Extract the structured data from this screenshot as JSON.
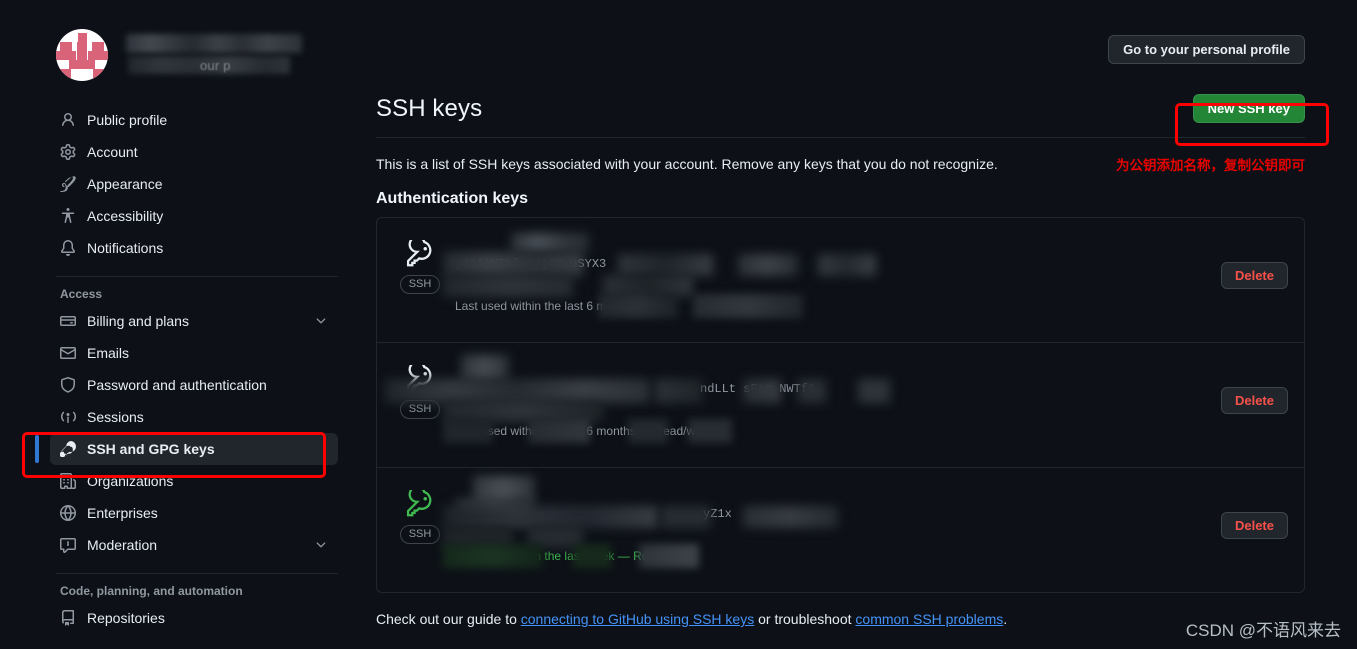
{
  "window": {
    "bg_color": "#0d1117",
    "accent_green": "#238636",
    "annotation_red": "#ff0000"
  },
  "sidebar": {
    "profile": {
      "name_redacted": "",
      "subtitle_partial": "our p"
    },
    "items": [
      {
        "label": "Public profile",
        "icon": "person-icon",
        "active": false,
        "chevron": false
      },
      {
        "label": "Account",
        "icon": "gear-icon",
        "active": false,
        "chevron": false
      },
      {
        "label": "Appearance",
        "icon": "paintbrush-icon",
        "active": false,
        "chevron": false
      },
      {
        "label": "Accessibility",
        "icon": "accessibility-icon",
        "active": false,
        "chevron": false
      },
      {
        "label": "Notifications",
        "icon": "bell-icon",
        "active": false,
        "chevron": false
      }
    ],
    "access_section": {
      "label": "Access",
      "items": [
        {
          "label": "Billing and plans",
          "icon": "credit-card-icon",
          "active": false,
          "chevron": true
        },
        {
          "label": "Emails",
          "icon": "mail-icon",
          "active": false,
          "chevron": false
        },
        {
          "label": "Password and authentication",
          "icon": "shield-icon",
          "active": false,
          "chevron": false
        },
        {
          "label": "Sessions",
          "icon": "broadcast-icon",
          "active": false,
          "chevron": false
        },
        {
          "label": "SSH and GPG keys",
          "icon": "key-icon",
          "active": true,
          "chevron": false
        },
        {
          "label": "Organizations",
          "icon": "organization-icon",
          "active": false,
          "chevron": false
        },
        {
          "label": "Enterprises",
          "icon": "globe-icon",
          "active": false,
          "chevron": false
        },
        {
          "label": "Moderation",
          "icon": "report-icon",
          "active": false,
          "chevron": true
        }
      ]
    },
    "code_section": {
      "label": "Code, planning, and automation",
      "items": [
        {
          "label": "Repositories",
          "icon": "repo-icon",
          "active": false,
          "chevron": false
        }
      ]
    }
  },
  "header": {
    "personal_profile_button": "Go to your personal profile",
    "title": "SSH keys",
    "new_key_button": "New SSH key",
    "description": "This is a list of SSH keys associated with your account. Remove any keys that you do not recognize.",
    "annotation_cn": "为公钥添加名称，复制公钥即可"
  },
  "main": {
    "section_heading": "Authentication keys",
    "keys": [
      {
        "title_redacted": true,
        "fingerprint_visible": "y232)MTbl        <jjCE           uSYX3",
        "added_redacted": true,
        "last_used": "Last used within the last 6 months",
        "last_used_recent": false,
        "icon_color": "white",
        "badge": "SSH",
        "delete_label": "Delete"
      },
      {
        "title_redacted": true,
        "fingerprint_visible": "ndLLt      sF+r     NWTf1",
        "added_redacted": true,
        "last_used": "Last used within the last 6 months — Read/write",
        "last_used_recent": false,
        "icon_color": "white",
        "badge": "SSH",
        "delete_label": "Delete"
      },
      {
        "title_redacted": true,
        "fingerprint_visible": "yZ1x",
        "added_redacted": true,
        "last_used": "Last used within the last week — Read/write",
        "last_used_recent": true,
        "icon_color": "green",
        "badge": "SSH",
        "delete_label": "Delete"
      }
    ],
    "footer": {
      "prefix": "Check out our guide to ",
      "link1": "connecting to GitHub using SSH keys",
      "middle": " or troubleshoot ",
      "link2": "common SSH problems",
      "suffix": "."
    }
  },
  "watermark": "CSDN @不语风来去"
}
